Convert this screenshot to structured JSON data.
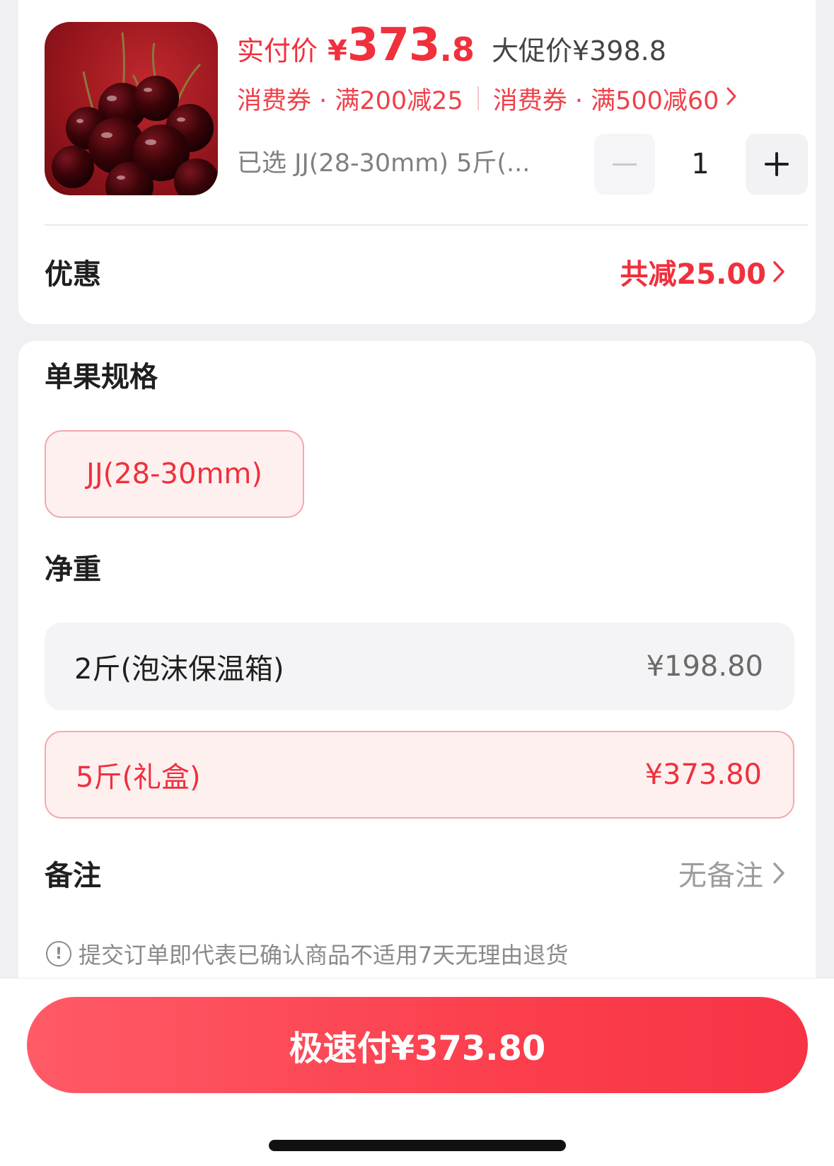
{
  "product": {
    "image_alt": "cherries",
    "pay_label": "实付价",
    "pay_currency": "¥",
    "pay_int": "373",
    "pay_dec": ".8",
    "promo_price": "大促价¥398.8",
    "coupons": [
      "消费券 · 满200减25",
      "消费券 · 满500减60"
    ],
    "selected": "已选 JJ(28-30mm) 5斤(...",
    "quantity": "1"
  },
  "discount": {
    "label": "优惠",
    "value": "共减25.00"
  },
  "spec": {
    "title": "单果规格",
    "options": [
      "JJ(28-30mm)"
    ]
  },
  "weight": {
    "title": "净重",
    "options": [
      {
        "label": "2斤(泡沫保温箱)",
        "price": "¥198.80"
      },
      {
        "label": "5斤(礼盒)",
        "price": "¥373.80"
      }
    ]
  },
  "note": {
    "label": "备注",
    "value": "无备注"
  },
  "notice": "提交订单即代表已确认商品不适用7天无理由退货",
  "pay_button": "极速付¥373.80",
  "colors": {
    "accent": "#f0303d",
    "chip_bg": "#fff0f0",
    "chip_border": "#f5a9ae"
  }
}
